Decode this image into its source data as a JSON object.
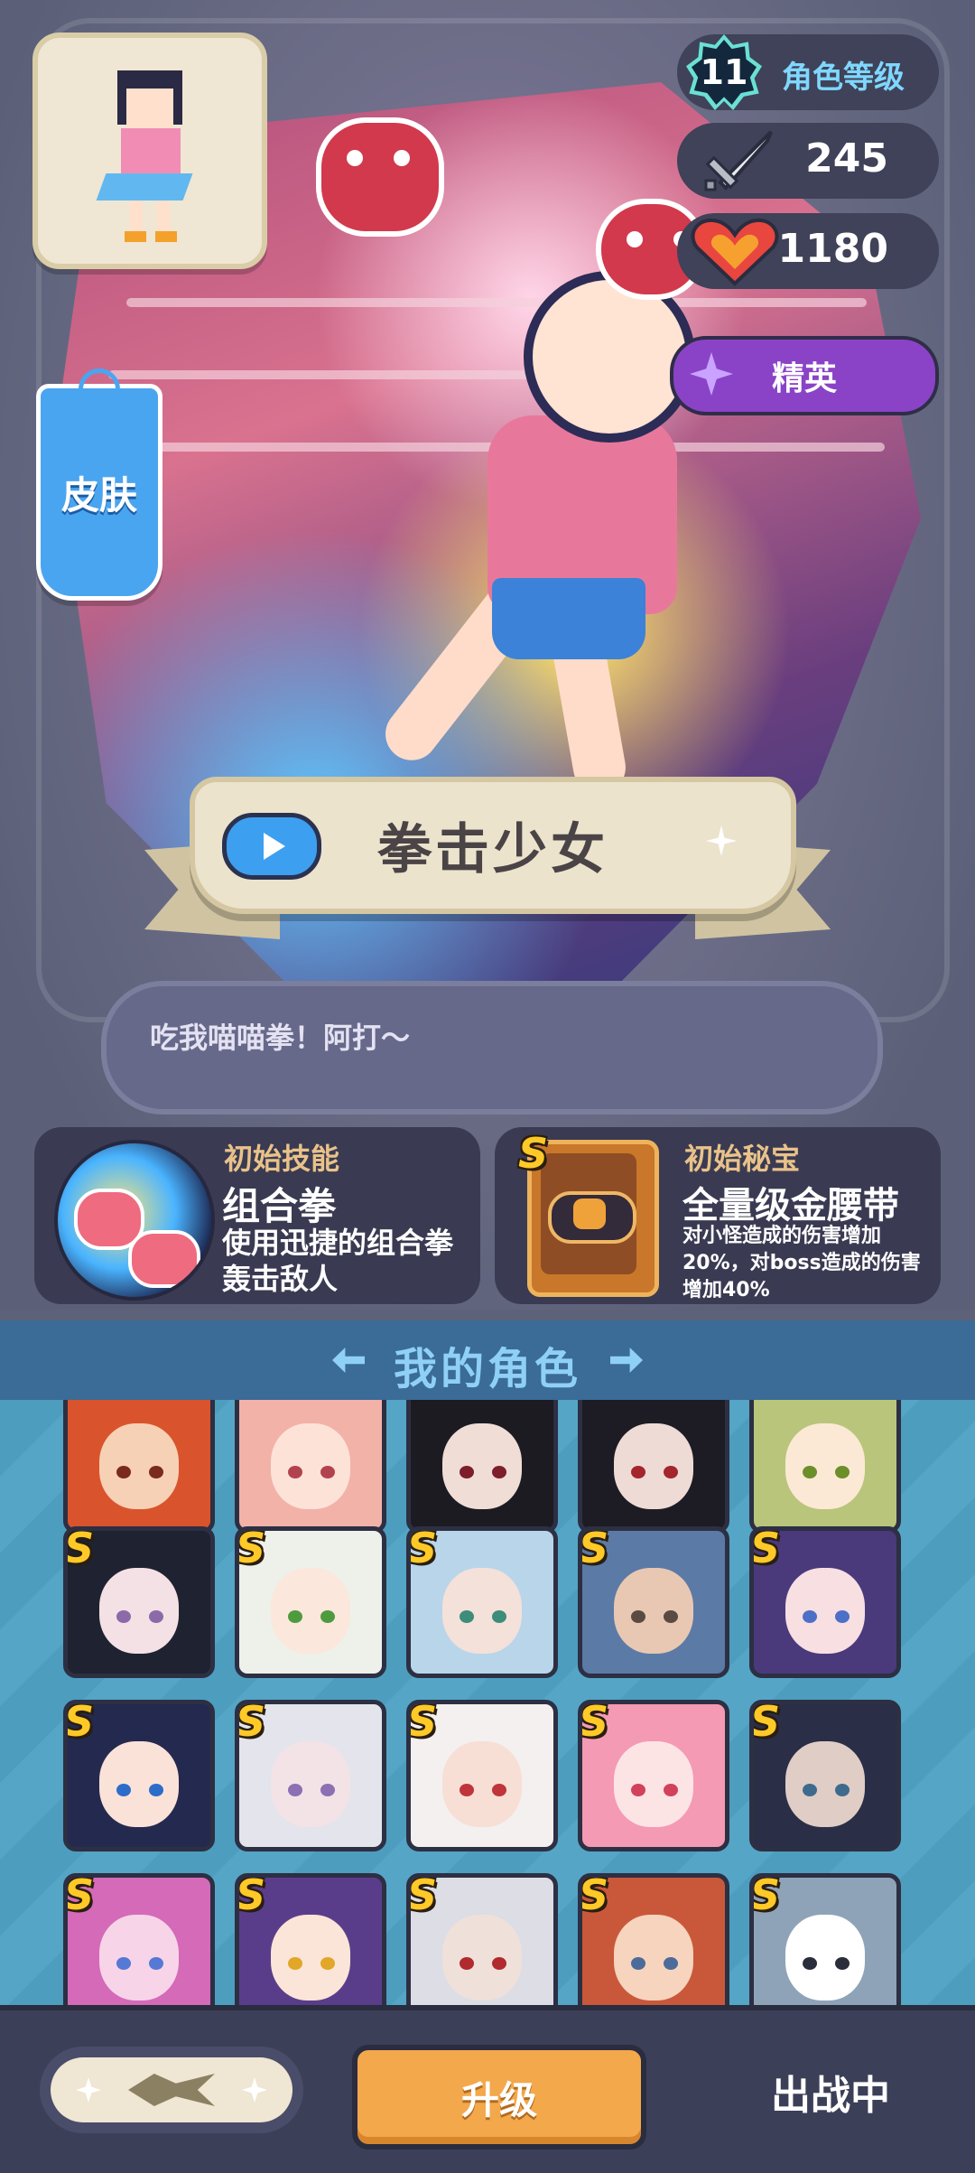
{
  "stats": {
    "level_value": "11",
    "level_label": "角色等级",
    "attack": "245",
    "health": "1180",
    "rank": "精英"
  },
  "skin_button": "皮肤",
  "hero": {
    "name": "拳击少女",
    "quote": "吃我喵喵拳！阿打～"
  },
  "skill": {
    "category": "初始技能",
    "name": "组合拳",
    "desc": "使用迅捷的组合拳轰击敌人"
  },
  "treasure": {
    "category": "初始秘宝",
    "name": "全量级金腰带",
    "desc": "对小怪造成的伤害增加20%，对boss造成的伤害增加40%",
    "grade": "S"
  },
  "roster": {
    "title": "我的角色",
    "grade_badge": "S",
    "tiles": [
      {
        "hair": "#d9542c",
        "skin": "#f7d1b5",
        "eye": "#7a2a1e",
        "s": false
      },
      {
        "hair": "#f2b2a8",
        "skin": "#fde2d8",
        "eye": "#b2434e",
        "s": false
      },
      {
        "hair": "#1c1b22",
        "skin": "#f0ddd6",
        "eye": "#7c1f2a",
        "s": false
      },
      {
        "hair": "#1d1c24",
        "skin": "#efdbd5",
        "eye": "#a3252d",
        "s": false
      },
      {
        "hair": "#b9c57a",
        "skin": "#fbe9d6",
        "eye": "#6c8f2a",
        "s": false
      },
      {
        "hair": "#1f2230",
        "skin": "#f3e1e6",
        "eye": "#8c6aa8",
        "s": true
      },
      {
        "hair": "#eef0ea",
        "skin": "#fbe7dc",
        "eye": "#4e9b3f",
        "s": true
      },
      {
        "hair": "#b9d5ea",
        "skin": "#f4e1d9",
        "eye": "#3e8c7a",
        "s": true
      },
      {
        "hair": "#5c7aa6",
        "skin": "#e8c8b2",
        "eye": "#5a4a42",
        "s": true
      },
      {
        "hair": "#4a3a7c",
        "skin": "#f7dfe2",
        "eye": "#4d6fc7",
        "s": true
      },
      {
        "hair": "#24294f",
        "skin": "#fbe2d8",
        "eye": "#2d6cc9",
        "s": true
      },
      {
        "hair": "#e4e4ec",
        "skin": "#f3e3e6",
        "eye": "#8d6fb4",
        "s": true
      },
      {
        "hair": "#f3f0ef",
        "skin": "#f7dfd6",
        "eye": "#c0343b",
        "s": true
      },
      {
        "hair": "#f49ab4",
        "skin": "#fde4e4",
        "eye": "#d2415b",
        "s": true
      },
      {
        "hair": "#2a2e46",
        "skin": "#e0cdc6",
        "eye": "#3e6b8d",
        "s": true
      },
      {
        "hair": "#d46ab8",
        "skin": "#f7d4e8",
        "eye": "#5579d4",
        "s": true
      },
      {
        "hair": "#5a3d8a",
        "skin": "#fbe5d8",
        "eye": "#e2a628",
        "s": true
      },
      {
        "hair": "#dcdde5",
        "skin": "#efe0da",
        "eye": "#b02a2e",
        "s": true
      },
      {
        "hair": "#c9583a",
        "skin": "#f6d4be",
        "eye": "#4d6b9a",
        "s": true
      },
      {
        "hair": "#8fa3b8",
        "skin": "#ffffff",
        "eye": "#2a2d3a",
        "s": true
      }
    ]
  },
  "bottom": {
    "upgrade": "升级",
    "deployed": "出战中"
  },
  "colors": {
    "accent_gold": "#ffc928",
    "upgrade_orange": "#f3a84c",
    "rank_purple": "#8a43c7",
    "skin_blue": "#4aa5f0"
  }
}
